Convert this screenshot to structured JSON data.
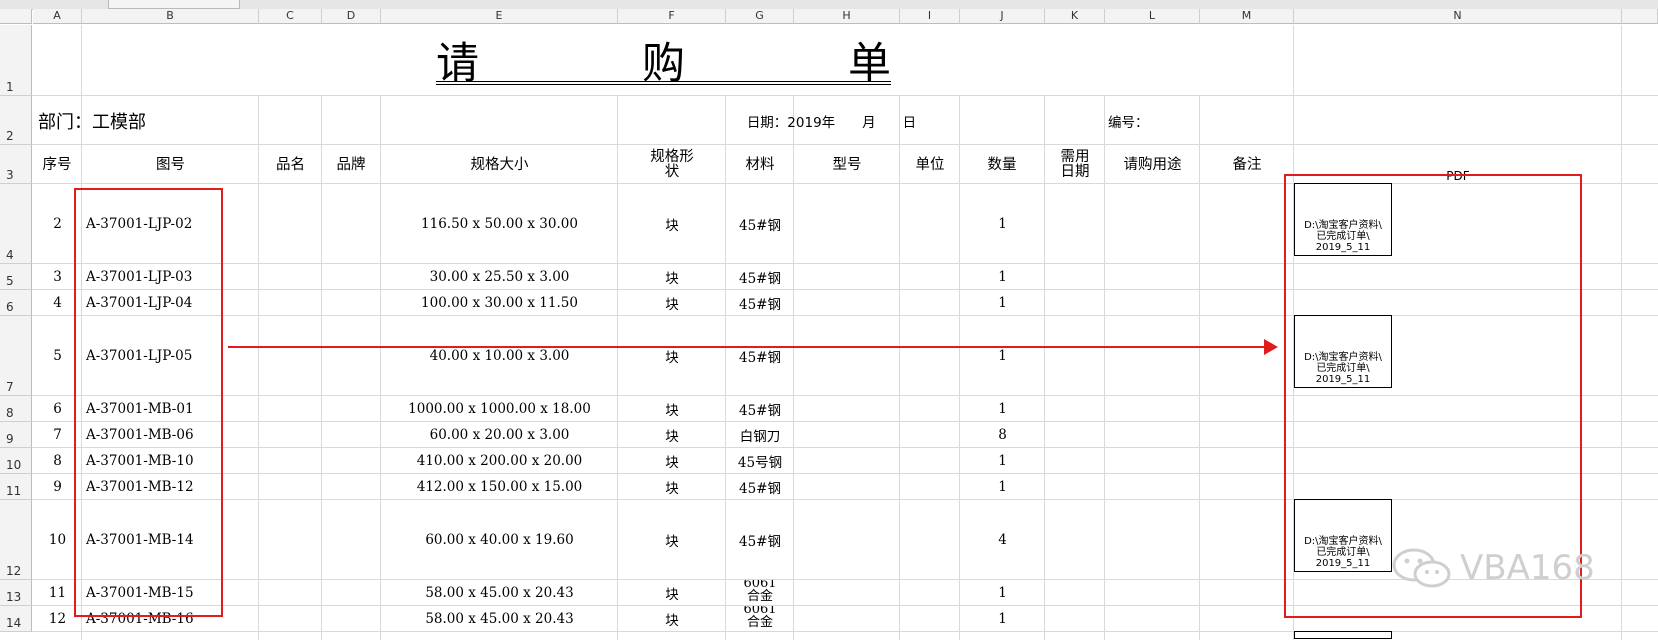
{
  "columns": [
    "A",
    "B",
    "C",
    "D",
    "E",
    "F",
    "G",
    "H",
    "I",
    "J",
    "K",
    "L",
    "M",
    "N"
  ],
  "row_numbers": [
    "1",
    "2",
    "3",
    "4",
    "5",
    "6",
    "7",
    "8",
    "9",
    "10",
    "11",
    "12",
    "13",
    "14"
  ],
  "title_chars": [
    "请",
    "购",
    "单"
  ],
  "department": "部门：工模部",
  "date_label": "日期：2019年　　月　　日",
  "number_label": "编号：",
  "headers": {
    "seq": "序号",
    "drawing": "图号",
    "name": "品名",
    "brand": "品牌",
    "spec": "规格大小",
    "shape": "规格形状",
    "material": "材料",
    "model": "型号",
    "unit": "单位",
    "qty": "数量",
    "need_date": "需用日期",
    "purpose": "请购用途",
    "remark": "备注",
    "pdf": "PDF"
  },
  "rows": [
    {
      "seq": "2",
      "drawing": "A-37001-LJP-02",
      "spec": "116.50 x 50.00 x 30.00",
      "shape": "块",
      "material": "45#钢",
      "qty": "1"
    },
    {
      "seq": "3",
      "drawing": "A-37001-LJP-03",
      "spec": "30.00 x 25.50 x 3.00",
      "shape": "块",
      "material": "45#钢",
      "qty": "1"
    },
    {
      "seq": "4",
      "drawing": "A-37001-LJP-04",
      "spec": "100.00 x 30.00 x 11.50",
      "shape": "块",
      "material": "45#钢",
      "qty": "1"
    },
    {
      "seq": "5",
      "drawing": "A-37001-LJP-05",
      "spec": "40.00 x 10.00 x 3.00",
      "shape": "块",
      "material": "45#钢",
      "qty": "1"
    },
    {
      "seq": "6",
      "drawing": "A-37001-MB-01",
      "spec": "1000.00 x 1000.00 x 18.00",
      "shape": "块",
      "material": "45#钢",
      "qty": "1"
    },
    {
      "seq": "7",
      "drawing": "A-37001-MB-06",
      "spec": "60.00 x 20.00 x 3.00",
      "shape": "块",
      "material": "白钢刀",
      "qty": "8"
    },
    {
      "seq": "8",
      "drawing": "A-37001-MB-10",
      "spec": "410.00 x 200.00 x 20.00",
      "shape": "块",
      "material": "45号钢",
      "qty": "1"
    },
    {
      "seq": "9",
      "drawing": "A-37001-MB-12",
      "spec": "412.00 x 150.00 x 15.00",
      "shape": "块",
      "material": "45#钢",
      "qty": "1"
    },
    {
      "seq": "10",
      "drawing": "A-37001-MB-14",
      "spec": "60.00 x 40.00 x 19.60",
      "shape": "块",
      "material": "45#钢",
      "qty": "4"
    },
    {
      "seq": "11",
      "drawing": "A-37001-MB-15",
      "spec": "58.00 x 45.00 x 20.43",
      "shape": "块",
      "material": "6061 合金",
      "qty": "1"
    },
    {
      "seq": "12",
      "drawing": "A-37001-MB-16",
      "spec": "58.00 x 45.00 x 20.43",
      "shape": "块",
      "material": "6061 合金",
      "qty": "1"
    }
  ],
  "pdf_objects": [
    {
      "line1": "D:\\淘宝客户资料\\",
      "line2": "已完成订单\\",
      "line3": "2019_5_11"
    },
    {
      "line1": "D:\\淘宝客户资料\\",
      "line2": "已完成订单\\",
      "line3": "2019_5_11"
    },
    {
      "line1": "D:\\淘宝客户资料\\",
      "line2": "已完成订单\\",
      "line3": "2019_5_11"
    }
  ],
  "watermark": "VBA168",
  "colors": {
    "annotation_red": "#e21c1c",
    "grid": "#d9d9d9",
    "header_bg": "#f3f3f3"
  }
}
